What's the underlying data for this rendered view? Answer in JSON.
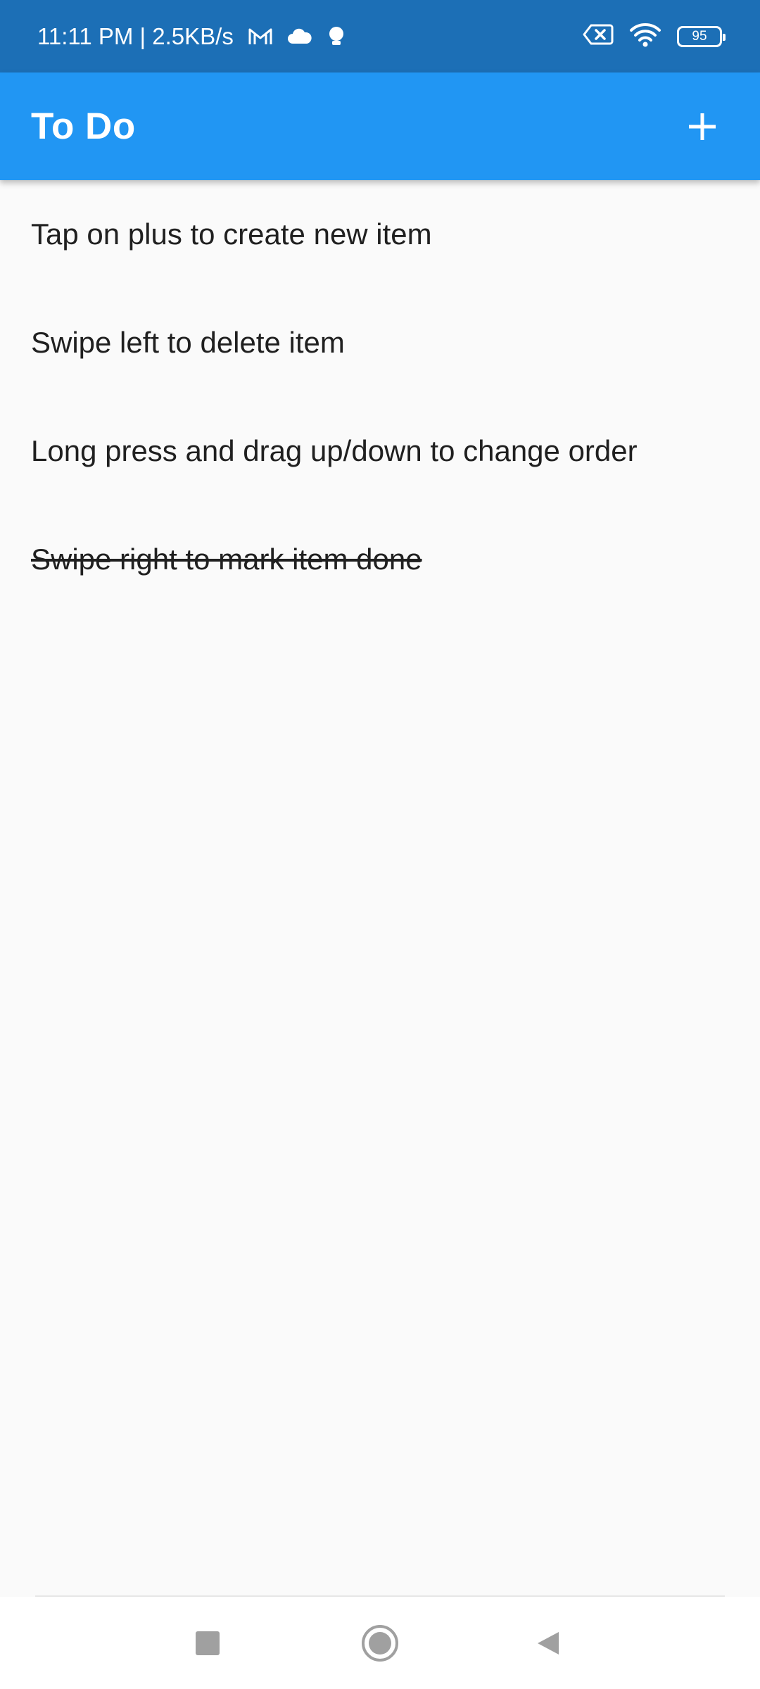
{
  "status_bar": {
    "time_speed": "11:11 PM | 2.5KB/s",
    "icons": [
      "gmail-icon",
      "cloud-icon",
      "notification-icon"
    ],
    "right_icons": [
      "sim-error-icon",
      "wifi-icon",
      "battery-icon"
    ],
    "battery_level": "95"
  },
  "app_bar": {
    "title": "To Do",
    "add_icon": "plus-icon",
    "background": "#2196f3"
  },
  "todos": [
    {
      "text": "Tap on plus to create new item",
      "done": false
    },
    {
      "text": "Swipe left to delete item",
      "done": false
    },
    {
      "text": "Long press and drag up/down to change order",
      "done": false
    },
    {
      "text": "Swipe right to mark item done",
      "done": true
    }
  ],
  "nav_bar": {
    "buttons": [
      "recents-icon",
      "home-icon",
      "back-icon"
    ]
  }
}
